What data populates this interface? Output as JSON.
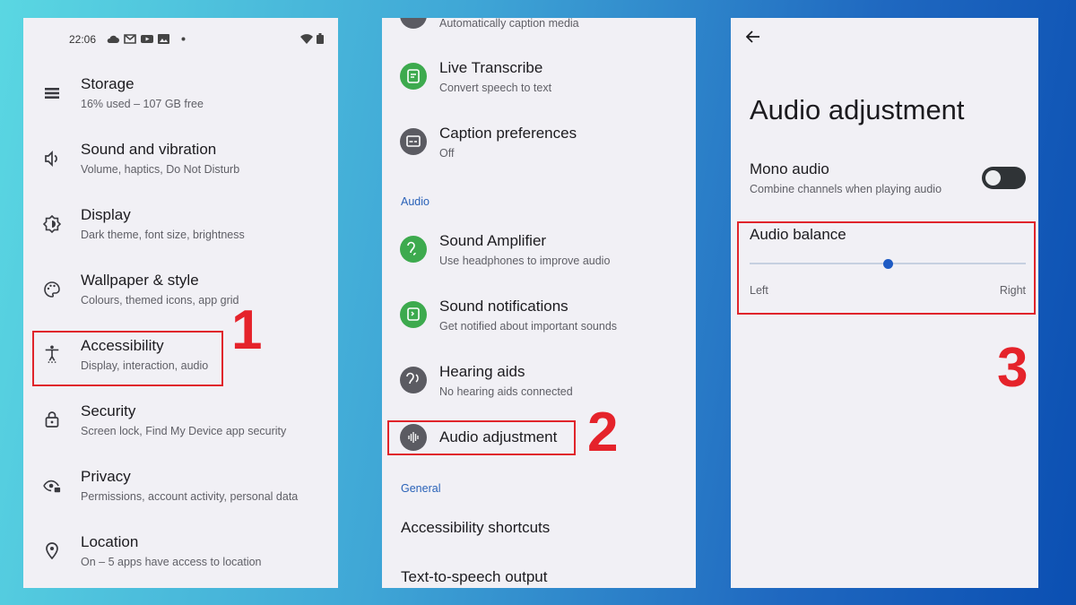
{
  "panel1": {
    "status": {
      "time": "22:06"
    },
    "items": [
      {
        "title": "Storage",
        "subtitle": "16% used – 107 GB free",
        "icon": "storage-icon"
      },
      {
        "title": "Sound and vibration",
        "subtitle": "Volume, haptics, Do Not Disturb",
        "icon": "volume-icon"
      },
      {
        "title": "Display",
        "subtitle": "Dark theme, font size, brightness",
        "icon": "brightness-icon"
      },
      {
        "title": "Wallpaper & style",
        "subtitle": "Colours, themed icons, app grid",
        "icon": "palette-icon"
      },
      {
        "title": "Accessibility",
        "subtitle": "Display, interaction, audio",
        "icon": "accessibility-icon"
      },
      {
        "title": "Security",
        "subtitle": "Screen lock, Find My Device app security",
        "icon": "lock-icon"
      },
      {
        "title": "Privacy",
        "subtitle": "Permissions, account activity, personal data",
        "icon": "eye-lock-icon"
      },
      {
        "title": "Location",
        "subtitle": "On – 5 apps have access to location",
        "icon": "location-pin-icon"
      }
    ]
  },
  "panel2": {
    "top_partial": "Automatically caption media",
    "items": [
      {
        "title": "Live Transcribe",
        "subtitle": "Convert speech to text",
        "icon": "live-transcribe-icon"
      },
      {
        "title": "Caption preferences",
        "subtitle": "Off",
        "icon": "caption-icon"
      }
    ],
    "section_audio": "Audio",
    "audio_items": [
      {
        "title": "Sound Amplifier",
        "subtitle": "Use headphones to improve audio",
        "icon": "ear-icon"
      },
      {
        "title": "Sound notifications",
        "subtitle": "Get notified about important sounds",
        "icon": "sound-notification-icon"
      },
      {
        "title": "Hearing aids",
        "subtitle": "No hearing aids connected",
        "icon": "hearing-aid-icon"
      },
      {
        "title": "Audio adjustment",
        "subtitle": "",
        "icon": "waveform-icon"
      }
    ],
    "section_general": "General",
    "general_items": [
      "Accessibility shortcuts",
      "Text-to-speech output"
    ]
  },
  "panel3": {
    "title": "Audio adjustment",
    "mono": {
      "title": "Mono audio",
      "subtitle": "Combine channels when playing audio",
      "enabled": false
    },
    "balance": {
      "title": "Audio balance",
      "left": "Left",
      "right": "Right",
      "value": 0.5
    }
  },
  "steps": [
    "1",
    "2",
    "3"
  ],
  "colors": {
    "highlight": "#e0242b",
    "green_icon": "#3daa4e",
    "gray_icon": "#5b5b62",
    "accent": "#1f5bc4"
  }
}
